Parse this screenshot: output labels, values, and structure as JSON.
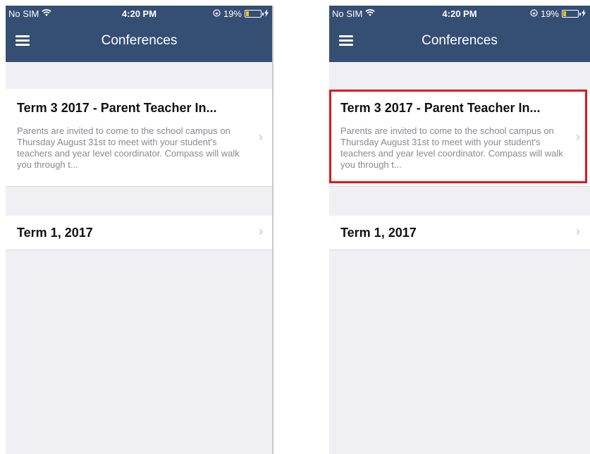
{
  "status_bar": {
    "carrier": "No SIM",
    "time": "4:20 PM",
    "battery_percent": "19%",
    "battery_level": 0.19
  },
  "nav": {
    "title": "Conferences"
  },
  "conferences": [
    {
      "title": "Term 3 2017 - Parent Teacher In...",
      "description": "Parents are invited to come to the school campus on Thursday August 31st to meet with your student's teachers and year level coordinator. Compass will walk you through t..."
    },
    {
      "title": "Term 1, 2017",
      "description": ""
    }
  ],
  "colors": {
    "header": "#344e74",
    "highlight": "#e1141b",
    "background": "#efeff4"
  },
  "icons": {
    "menu": "hamburger-menu-icon",
    "wifi": "wifi-icon",
    "lock": "rotation-lock-icon",
    "battery": "battery-icon",
    "charging": "charging-bolt-icon",
    "chevron": "chevron-right-icon"
  }
}
